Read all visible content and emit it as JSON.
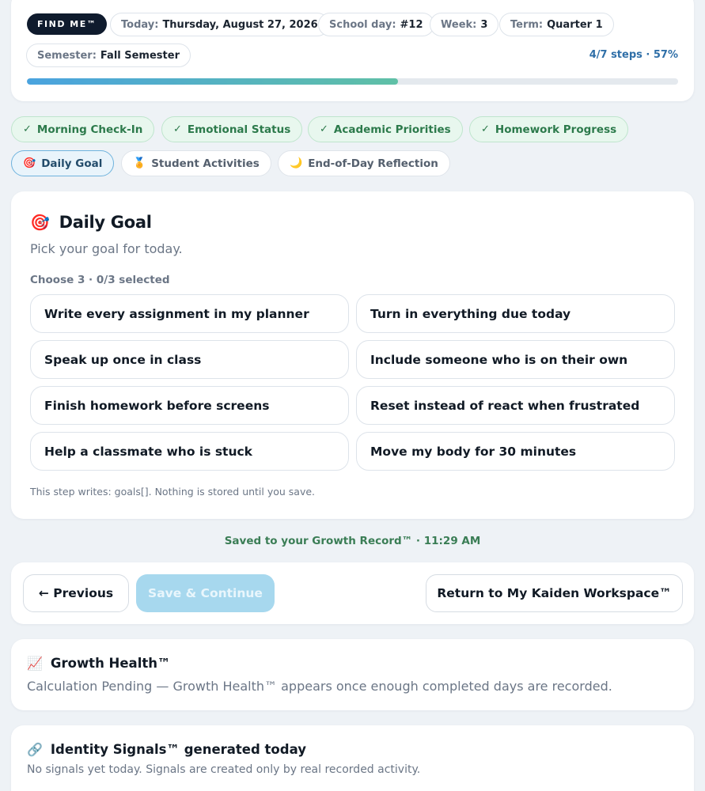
{
  "header": {
    "badge": "FIND ME™",
    "pills": [
      {
        "k": "Today:",
        "v": "Thursday, August 27, 2026"
      },
      {
        "k": "School day:",
        "v": "#12"
      },
      {
        "k": "Week:",
        "v": "3"
      },
      {
        "k": "Term:",
        "v": "Quarter 1"
      },
      {
        "k": "Semester:",
        "v": "Fall Semester"
      }
    ],
    "progress_text": "4/7 steps · 57%",
    "progress_fraction": 0.57
  },
  "steps": [
    {
      "label": "Morning Check-In",
      "icon": "check-icon",
      "glyph": "✓",
      "state": "done"
    },
    {
      "label": "Emotional Status",
      "icon": "check-icon",
      "glyph": "✓",
      "state": "done"
    },
    {
      "label": "Academic Priorities",
      "icon": "check-icon",
      "glyph": "✓",
      "state": "done"
    },
    {
      "label": "Homework Progress",
      "icon": "check-icon",
      "glyph": "✓",
      "state": "done"
    },
    {
      "label": "Daily Goal",
      "icon": "target-icon",
      "glyph": "🎯",
      "state": "active"
    },
    {
      "label": "Student Activities",
      "icon": "medal-icon",
      "glyph": "🏅",
      "state": "todo"
    },
    {
      "label": "End-of-Day Reflection",
      "icon": "moon-icon",
      "glyph": "🌙",
      "state": "todo"
    }
  ],
  "goal": {
    "icon_glyph": "🎯",
    "title": "Daily Goal",
    "subtitle": "Pick your goal for today.",
    "choose": "Choose 3 · 0/3 selected",
    "options": [
      "Write every assignment in my planner",
      "Turn in everything due today",
      "Speak up once in class",
      "Include someone who is on their own",
      "Finish homework before screens",
      "Reset instead of react when frustrated",
      "Help a classmate who is stuck",
      "Move my body for 30 minutes"
    ],
    "note": "This step writes: goals[]. Nothing is stored until you save."
  },
  "saved_status": "Saved to your Growth Record™ · 11:29 AM",
  "nav": {
    "previous": "← Previous",
    "save_continue": "Save & Continue",
    "return": "Return to My Kaiden Workspace™"
  },
  "growth": {
    "icon_glyph": "📈",
    "title": "Growth Health™",
    "body": "Calculation Pending — Growth Health™ appears once enough completed days are recorded."
  },
  "identity": {
    "icon_glyph": "🔗",
    "title": "Identity Signals™ generated today",
    "body": "No signals yet today. Signals are created only by real recorded activity."
  },
  "colors": {
    "done": "#2c7a4b",
    "active": "#6fb3dd",
    "accent_blue": "#2f6fa8",
    "save_disabled": "#a7d8ee"
  }
}
